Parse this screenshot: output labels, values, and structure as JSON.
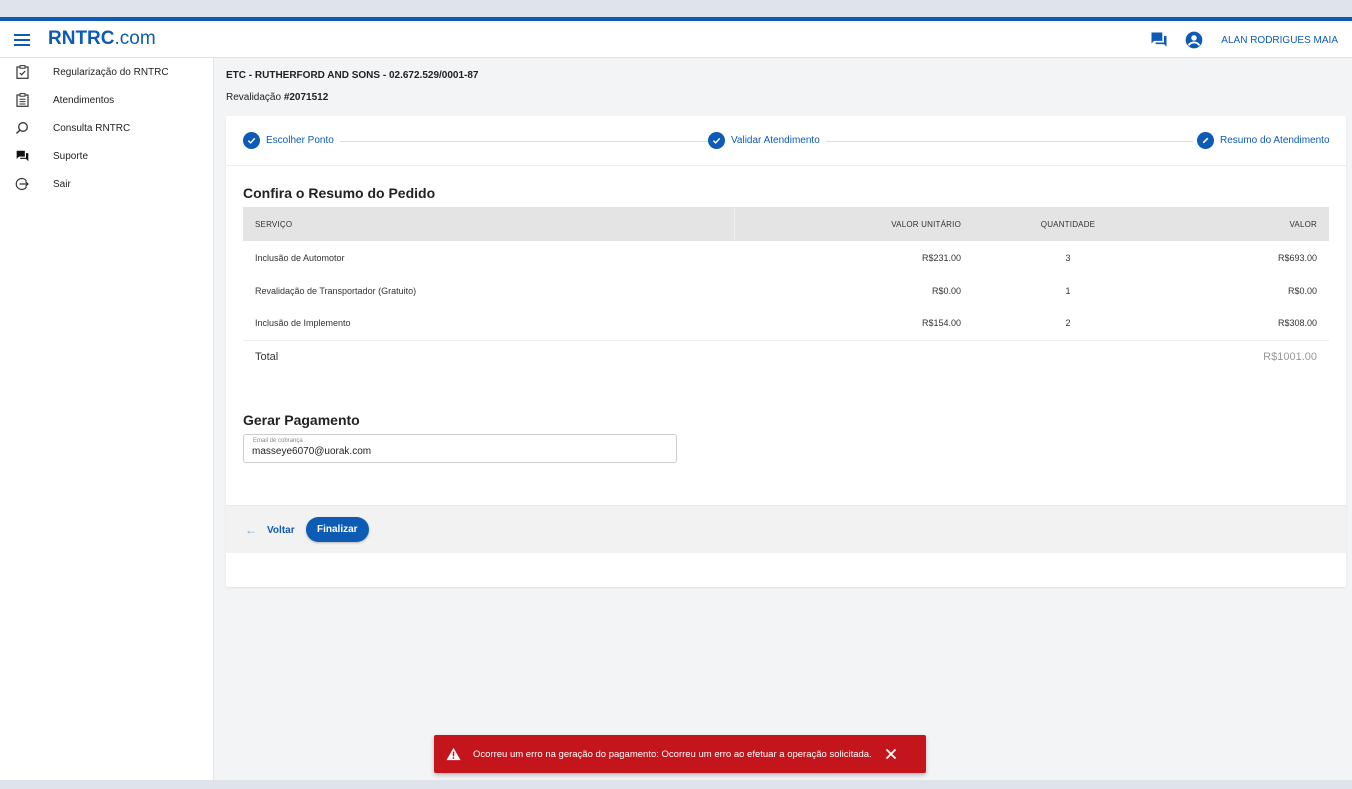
{
  "header": {
    "logo_bold": "RNTRC",
    "logo_light": ".com",
    "user_name": "ALAN RODRIGUES MAIA"
  },
  "sidebar": {
    "items": [
      {
        "label": "Regularização do RNTRC",
        "icon": "clipboard-check-icon"
      },
      {
        "label": "Atendimentos",
        "icon": "clipboard-list-icon"
      },
      {
        "label": "Consulta RNTRC",
        "icon": "search-icon"
      },
      {
        "label": "Suporte",
        "icon": "chat-icon"
      },
      {
        "label": "Sair",
        "icon": "logout-icon"
      }
    ]
  },
  "page": {
    "company": "ETC - RUTHERFORD AND SONS - 02.672.529/0001-87",
    "revalidation_prefix": "Revalidação ",
    "revalidation_id": "#2071512"
  },
  "stepper": {
    "steps": [
      {
        "label": "Escolher Ponto",
        "state": "done"
      },
      {
        "label": "Validar Atendimento",
        "state": "done"
      },
      {
        "label": "Resumo do Atendimento",
        "state": "edit"
      }
    ]
  },
  "summary": {
    "title": "Confira o Resumo do Pedido",
    "columns": [
      "SERVIÇO",
      "VALOR UNITÁRIO",
      "QUANTIDADE",
      "VALOR"
    ],
    "rows": [
      {
        "service": "Inclusão de Automotor",
        "unit": "R$231.00",
        "qty": "3",
        "value": "R$693.00"
      },
      {
        "service": "Revalidação de Transportador (Gratuito)",
        "unit": "R$0.00",
        "qty": "1",
        "value": "R$0.00"
      },
      {
        "service": "Inclusão de Implemento",
        "unit": "R$154.00",
        "qty": "2",
        "value": "R$308.00"
      }
    ],
    "total_label": "Total",
    "total_value": "R$1001.00"
  },
  "payment": {
    "title": "Gerar Pagamento",
    "email_label": "Email de cobrança",
    "email_value": "masseye6070@uorak.com"
  },
  "footer": {
    "back_label": "Voltar",
    "finalize_label": "Finalizar"
  },
  "toast": {
    "message": "Ocorreu um erro na geração do pagamento: Ocorreu um erro ao efetuar a operação solicitada."
  },
  "colors": {
    "primary": "#0d5bb5",
    "error": "#c4151c"
  }
}
